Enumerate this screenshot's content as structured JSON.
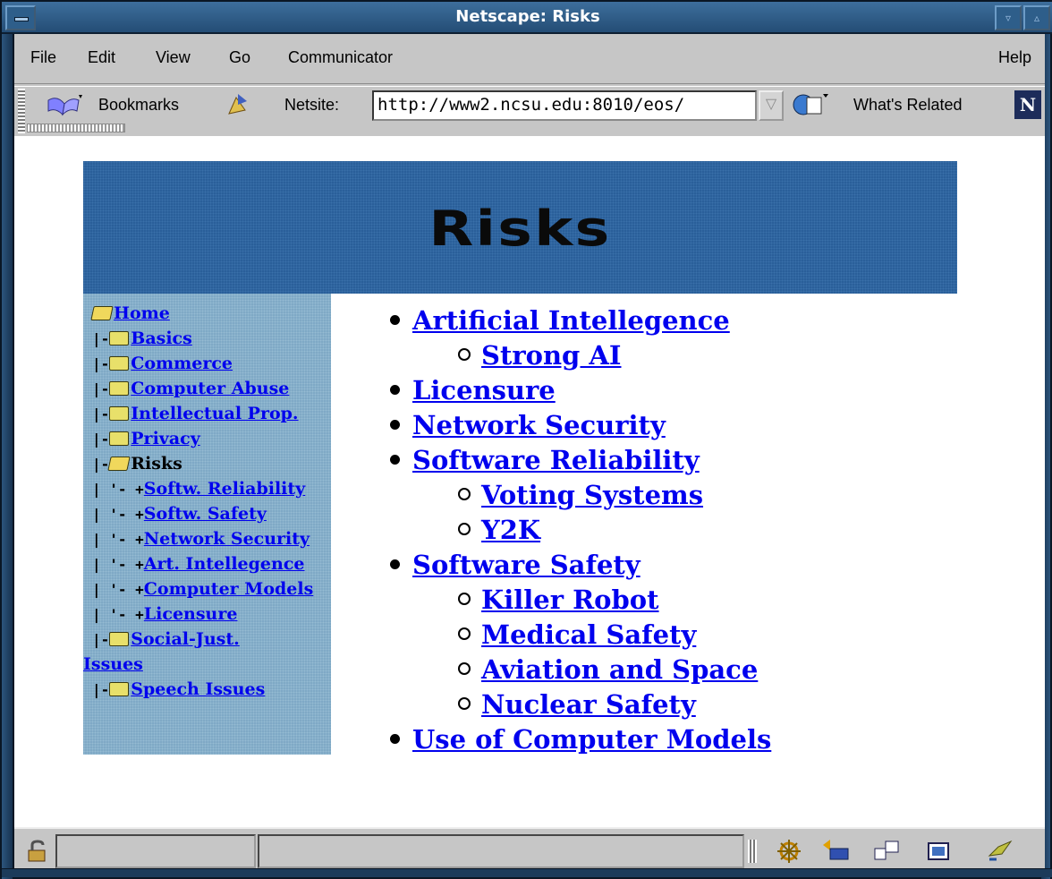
{
  "window": {
    "title": "Netscape: Risks"
  },
  "menu": [
    "File",
    "Edit",
    "View",
    "Go",
    "Communicator"
  ],
  "menu_help": "Help",
  "toolbar": {
    "bookmarks_label": "Bookmarks",
    "netsite_label": "Netsite:",
    "url": "http://www2.ncsu.edu:8010/eos/",
    "whats_related_label": "What's Related",
    "logo_letter": "N"
  },
  "banner": {
    "title": "Risks"
  },
  "sidebar": {
    "home": "Home",
    "items": [
      {
        "prefix": "|-",
        "label": "Basics",
        "type": "folder",
        "link": true
      },
      {
        "prefix": "|-",
        "label": "Commerce",
        "type": "folder",
        "link": true
      },
      {
        "prefix": "|-",
        "label": "Computer Abuse",
        "type": "folder",
        "link": true
      },
      {
        "prefix": "|-",
        "label": "Intellectual Prop.",
        "type": "folder",
        "link": true
      },
      {
        "prefix": "|-",
        "label": "Privacy",
        "type": "folder",
        "link": true
      },
      {
        "prefix": "|-",
        "label": "Risks",
        "type": "open-folder",
        "link": false
      },
      {
        "prefix": "| '- +",
        "label": "Softw. Reliability",
        "type": "leaf",
        "link": true
      },
      {
        "prefix": "| '- +",
        "label": "Softw. Safety",
        "type": "leaf",
        "link": true
      },
      {
        "prefix": "| '- +",
        "label": "Network Security",
        "type": "leaf",
        "link": true
      },
      {
        "prefix": "| '- +",
        "label": "Art. Intellegence",
        "type": "leaf",
        "link": true
      },
      {
        "prefix": "| '- +",
        "label": "Computer Models",
        "type": "leaf",
        "link": true
      },
      {
        "prefix": "| '- +",
        "label": "Licensure",
        "type": "leaf",
        "link": true
      },
      {
        "prefix": "|-",
        "label": "Social-Just.",
        "type": "folder",
        "link": true,
        "wrap": "Issues"
      },
      {
        "prefix": "|-",
        "label": "Speech Issues",
        "type": "folder",
        "link": true
      }
    ]
  },
  "main_list": [
    {
      "level": 1,
      "label": "Artificial Intellegence"
    },
    {
      "level": 2,
      "label": "Strong AI"
    },
    {
      "level": 1,
      "label": "Licensure"
    },
    {
      "level": 1,
      "label": "Network Security"
    },
    {
      "level": 1,
      "label": "Software Reliability"
    },
    {
      "level": 2,
      "label": "Voting Systems"
    },
    {
      "level": 2,
      "label": "Y2K"
    },
    {
      "level": 1,
      "label": "Software Safety"
    },
    {
      "level": 2,
      "label": "Killer Robot"
    },
    {
      "level": 2,
      "label": "Medical Safety"
    },
    {
      "level": 2,
      "label": "Aviation and Space"
    },
    {
      "level": 2,
      "label": "Nuclear Safety"
    },
    {
      "level": 1,
      "label": "Use of Computer Models"
    }
  ],
  "icons": {
    "security": "lock-icon",
    "components": [
      "navigator-icon",
      "mail-icon",
      "discussion-icon",
      "composer-icon",
      "proxy-icon"
    ]
  },
  "colors": {
    "link": "#0000ee",
    "banner": "#2a5f9a",
    "sidebar": "#7fa9c6",
    "chrome": "#c6c6c6"
  }
}
